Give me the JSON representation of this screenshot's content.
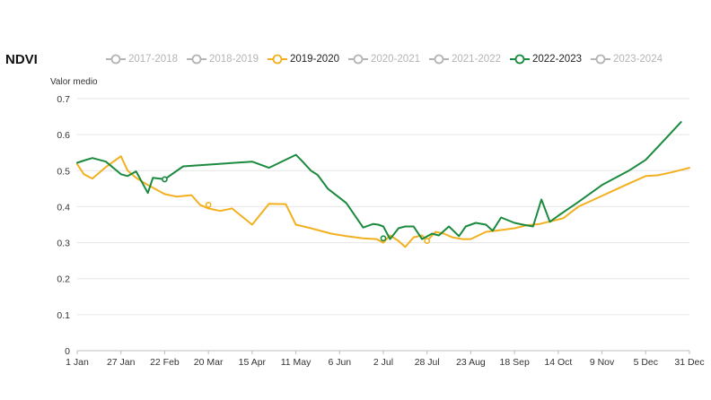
{
  "title": "NDVI",
  "legend": [
    {
      "label": "2017-2018",
      "color": "#b4b4b4",
      "active": false
    },
    {
      "label": "2018-2019",
      "color": "#b4b4b4",
      "active": false
    },
    {
      "label": "2019-2020",
      "color": "#f2b01e",
      "active": true
    },
    {
      "label": "2020-2021",
      "color": "#b4b4b4",
      "active": false
    },
    {
      "label": "2021-2022",
      "color": "#b4b4b4",
      "active": false
    },
    {
      "label": "2022-2023",
      "color": "#1a8a3e",
      "active": true
    },
    {
      "label": "2023-2024",
      "color": "#b4b4b4",
      "active": false
    }
  ],
  "chart_data": {
    "type": "line",
    "ylabel": "Valor medio",
    "ylim": [
      0,
      0.7
    ],
    "yticks": [
      "0",
      "0.1",
      "0.2",
      "0.3",
      "0.4",
      "0.5",
      "0.6",
      "0.7"
    ],
    "xlim": [
      "1 Jan",
      "31 Dec"
    ],
    "xticks": [
      "1 Jan",
      "27 Jan",
      "22 Feb",
      "20 Mar",
      "15 Apr",
      "11 May",
      "6 Jun",
      "2 Jul",
      "28 Jul",
      "23 Aug",
      "18 Sep",
      "14 Oct",
      "9 Nov",
      "5 Dec",
      "31 Dec"
    ],
    "grid": true,
    "series": [
      {
        "name": "2019-2020",
        "color": "#f2b01e",
        "x": [
          "1 Jan",
          "5 Jan",
          "10 Jan",
          "18 Jan",
          "27 Jan",
          "31 Jan",
          "5 Feb",
          "12 Feb",
          "22 Feb",
          "1 Mar",
          "10 Mar",
          "15 Mar",
          "20 Mar",
          "27 Mar",
          "3 Apr",
          "15 Apr",
          "25 Apr",
          "5 May",
          "11 May",
          "20 May",
          "1 Jun",
          "10 Jun",
          "20 Jun",
          "28 Jun",
          "2 Jul",
          "6 Jul",
          "11 Jul",
          "15 Jul",
          "20 Jul",
          "25 Jul",
          "28 Jul",
          "2 Aug",
          "7 Aug",
          "12 Aug",
          "18 Aug",
          "23 Aug",
          "1 Sep",
          "10 Sep",
          "18 Sep",
          "25 Sep",
          "3 Oct",
          "10 Oct",
          "17 Oct",
          "26 Oct",
          "9 Nov",
          "23 Nov",
          "5 Dec",
          "12 Dec",
          "20 Dec",
          "31 Dec"
        ],
        "y": [
          0.518,
          0.49,
          0.478,
          0.51,
          0.54,
          0.5,
          0.48,
          0.46,
          0.435,
          0.428,
          0.432,
          0.405,
          0.395,
          0.388,
          0.395,
          0.35,
          0.408,
          0.407,
          0.35,
          0.34,
          0.325,
          0.318,
          0.312,
          0.31,
          0.3,
          0.32,
          0.305,
          0.288,
          0.315,
          0.32,
          0.305,
          0.33,
          0.325,
          0.315,
          0.31,
          0.31,
          0.33,
          0.335,
          0.34,
          0.348,
          0.352,
          0.36,
          0.368,
          0.4,
          0.43,
          0.46,
          0.485,
          0.487,
          0.495,
          0.508
        ]
      },
      {
        "name": "2022-2023",
        "color": "#1a8a3e",
        "x": [
          "1 Jan",
          "5 Jan",
          "10 Jan",
          "18 Jan",
          "24 Jan",
          "27 Jan",
          "31 Jan",
          "5 Feb",
          "12 Feb",
          "15 Feb",
          "22 Feb",
          "5 Mar",
          "15 Apr",
          "25 Apr",
          "11 May",
          "14 May",
          "20 May",
          "24 May",
          "30 May",
          "10 Jun",
          "20 Jun",
          "26 Jun",
          "29 Jun",
          "2 Jul",
          "6 Jul",
          "11 Jul",
          "15 Jul",
          "20 Jul",
          "25 Jul",
          "31 Jul",
          "4 Aug",
          "10 Aug",
          "16 Aug",
          "20 Aug",
          "26 Aug",
          "1 Sep",
          "5 Sep",
          "10 Sep",
          "18 Sep",
          "23 Sep",
          "29 Sep",
          "4 Oct",
          "9 Oct",
          "14 Oct",
          "25 Oct",
          "9 Nov",
          "25 Nov",
          "5 Dec",
          "17 Dec",
          "26 Dec"
        ],
        "y": [
          0.522,
          0.528,
          0.535,
          0.525,
          0.502,
          0.49,
          0.485,
          0.498,
          0.438,
          0.48,
          0.476,
          0.512,
          0.525,
          0.508,
          0.544,
          0.53,
          0.5,
          0.488,
          0.45,
          0.41,
          0.342,
          0.352,
          0.35,
          0.345,
          0.31,
          0.34,
          0.345,
          0.345,
          0.31,
          0.325,
          0.32,
          0.345,
          0.318,
          0.345,
          0.355,
          0.35,
          0.333,
          0.37,
          0.355,
          0.35,
          0.345,
          0.42,
          0.358,
          0.375,
          0.41,
          0.46,
          0.5,
          0.53,
          0.59,
          0.635
        ]
      }
    ],
    "markers": [
      {
        "series": 0,
        "x": "20 Mar",
        "y": 0.405
      },
      {
        "series": 0,
        "x": "28 Jul",
        "y": 0.305
      },
      {
        "series": 1,
        "x": "22 Feb",
        "y": 0.476
      },
      {
        "series": 1,
        "x": "2 Jul",
        "y": 0.312
      }
    ]
  }
}
